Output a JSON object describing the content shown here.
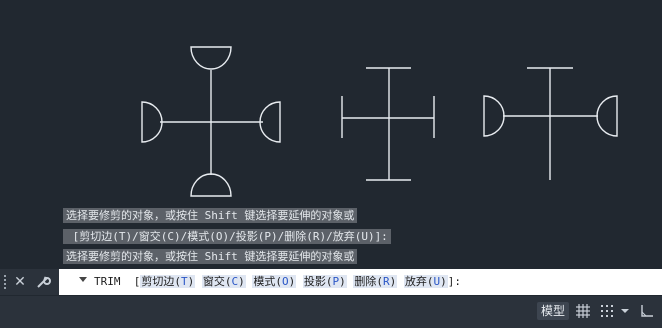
{
  "history": [
    "选择要修剪的对象，或按住 Shift 键选择要延伸的对象或",
    " [剪切边(T)/窗交(C)/模式(O)/投影(P)/删除(R)/放弃(U)]:",
    "选择要修剪的对象，或按住 Shift 键选择要延伸的对象或"
  ],
  "command": {
    "name": "TRIM",
    "open_bracket": "[",
    "close": "]:",
    "options": [
      {
        "text": "剪切边(",
        "key": "T",
        "end": ")"
      },
      {
        "text": "窗交(",
        "key": "C",
        "end": ")"
      },
      {
        "text": "模式(",
        "key": "O",
        "end": ")"
      },
      {
        "text": "投影(",
        "key": "P",
        "end": ")"
      },
      {
        "text": "删除(",
        "key": "R",
        "end": ")"
      },
      {
        "text": "放弃(",
        "key": "U",
        "end": ")"
      }
    ]
  },
  "status": {
    "model_label": "模型"
  },
  "colors": {
    "canvas_bg": "#212830",
    "drawing": "#e8ecf0",
    "history_bg": "#5c6168",
    "option_key": "#2a56c6"
  },
  "icons": [
    "close-icon",
    "wrench-icon",
    "dropdown-arrow-icon",
    "grid-icon",
    "snap-grid-icon",
    "chevron-down-icon",
    "ortho-icon"
  ]
}
